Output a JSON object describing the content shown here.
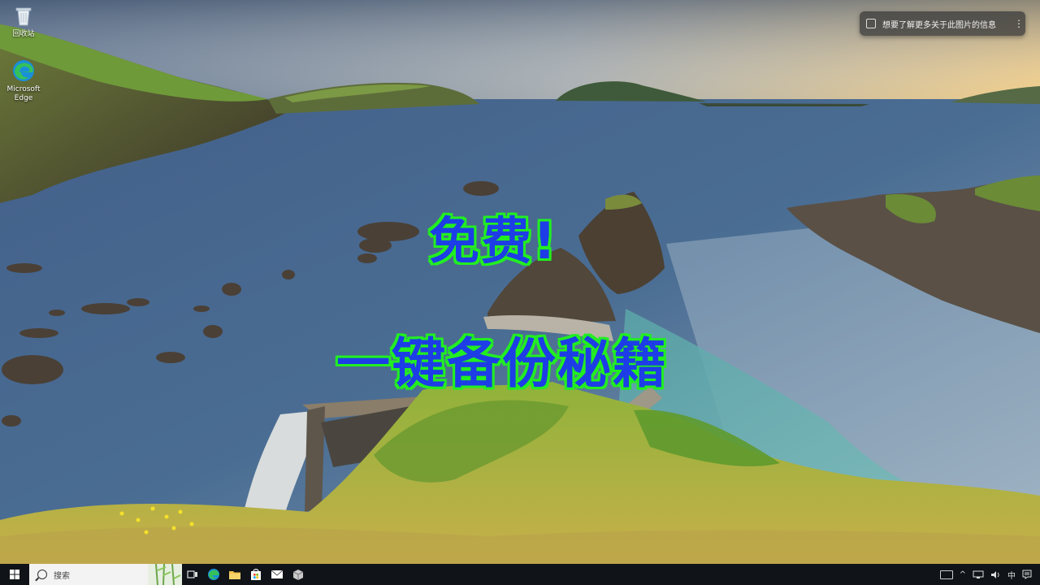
{
  "desktop": {
    "icons": [
      {
        "label": "回收站",
        "icon": "recycle-bin-icon"
      },
      {
        "label": "Microsoft Edge",
        "icon": "edge-browser-icon"
      }
    ]
  },
  "info_popup": {
    "text": "想要了解更多关于此图片的信息",
    "icon": "camera-lens-icon",
    "more_label": "⋮"
  },
  "overlay": {
    "line1": "免费!",
    "line2": "一键备份秘籍",
    "fill_color": "#1d3de6",
    "outline_color": "#22ee22"
  },
  "taskbar": {
    "search_placeholder": "搜索",
    "pinned": [
      "task-view-icon",
      "edge-icon",
      "file-explorer-icon",
      "microsoft-store-icon",
      "mail-icon",
      "package-icon"
    ],
    "tray": {
      "chevron": "^",
      "ime_label": "中",
      "keyboard": "keyboard-icon",
      "network": "network-icon",
      "volume": "volume-icon",
      "notifications": "notification-icon"
    }
  },
  "colors": {
    "taskbar_bg": "#101418",
    "sea": "#3f5f86",
    "sky_warm": "#e8c88a"
  }
}
